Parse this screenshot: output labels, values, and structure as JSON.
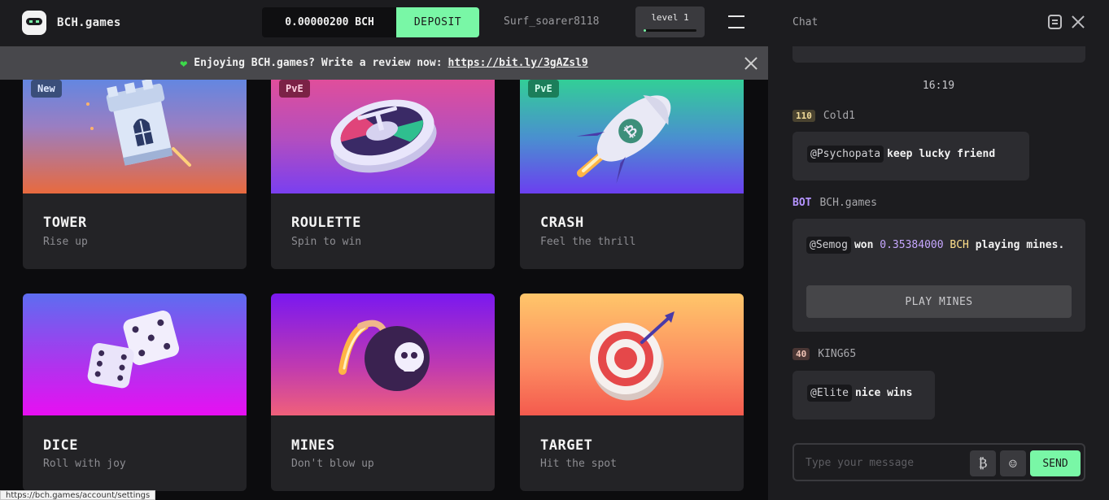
{
  "header": {
    "logo_text": "BCH.games",
    "balance": "0.00000200 BCH",
    "deposit_label": "DEPOSIT",
    "username": "Surf_soarer8118",
    "level_label": "level 1",
    "level_progress": 0.05,
    "accent_color": "#79f7a6"
  },
  "banner": {
    "text": "Enjoying BCH.games? Write a review now:",
    "link": "https://bit.ly/3gAZsl9"
  },
  "games": [
    {
      "title": "TOWER",
      "subtitle": "Rise up",
      "badge": "New"
    },
    {
      "title": "ROULETTE",
      "subtitle": "Spin to win",
      "badge": "PvE"
    },
    {
      "title": "CRASH",
      "subtitle": "Feel the thrill",
      "badge": "PvE"
    },
    {
      "title": "DICE",
      "subtitle": "Roll with joy",
      "badge": ""
    },
    {
      "title": "MINES",
      "subtitle": "Don't blow up",
      "badge": ""
    },
    {
      "title": "TARGET",
      "subtitle": "Hit the spot",
      "badge": ""
    }
  ],
  "chat": {
    "title": "Chat",
    "time": "16:19",
    "messages": [
      {
        "level": "110",
        "name": "Cold1",
        "mention": "@Psychopata",
        "text": "keep lucky friend"
      },
      {
        "tag": "BOT",
        "name": "BCH.games",
        "mention": "@Semog",
        "won": "won",
        "amount": "0.35384000",
        "currency": "BCH",
        "playing": "playing",
        "game": "mines.",
        "button": "PLAY MINES"
      },
      {
        "level": "40",
        "name": "KING65",
        "mention": "@Elite",
        "text": "nice wins"
      }
    ],
    "input_placeholder": "Type your message",
    "send_label": "SEND"
  },
  "status_bar": "https://bch.games/account/settings"
}
